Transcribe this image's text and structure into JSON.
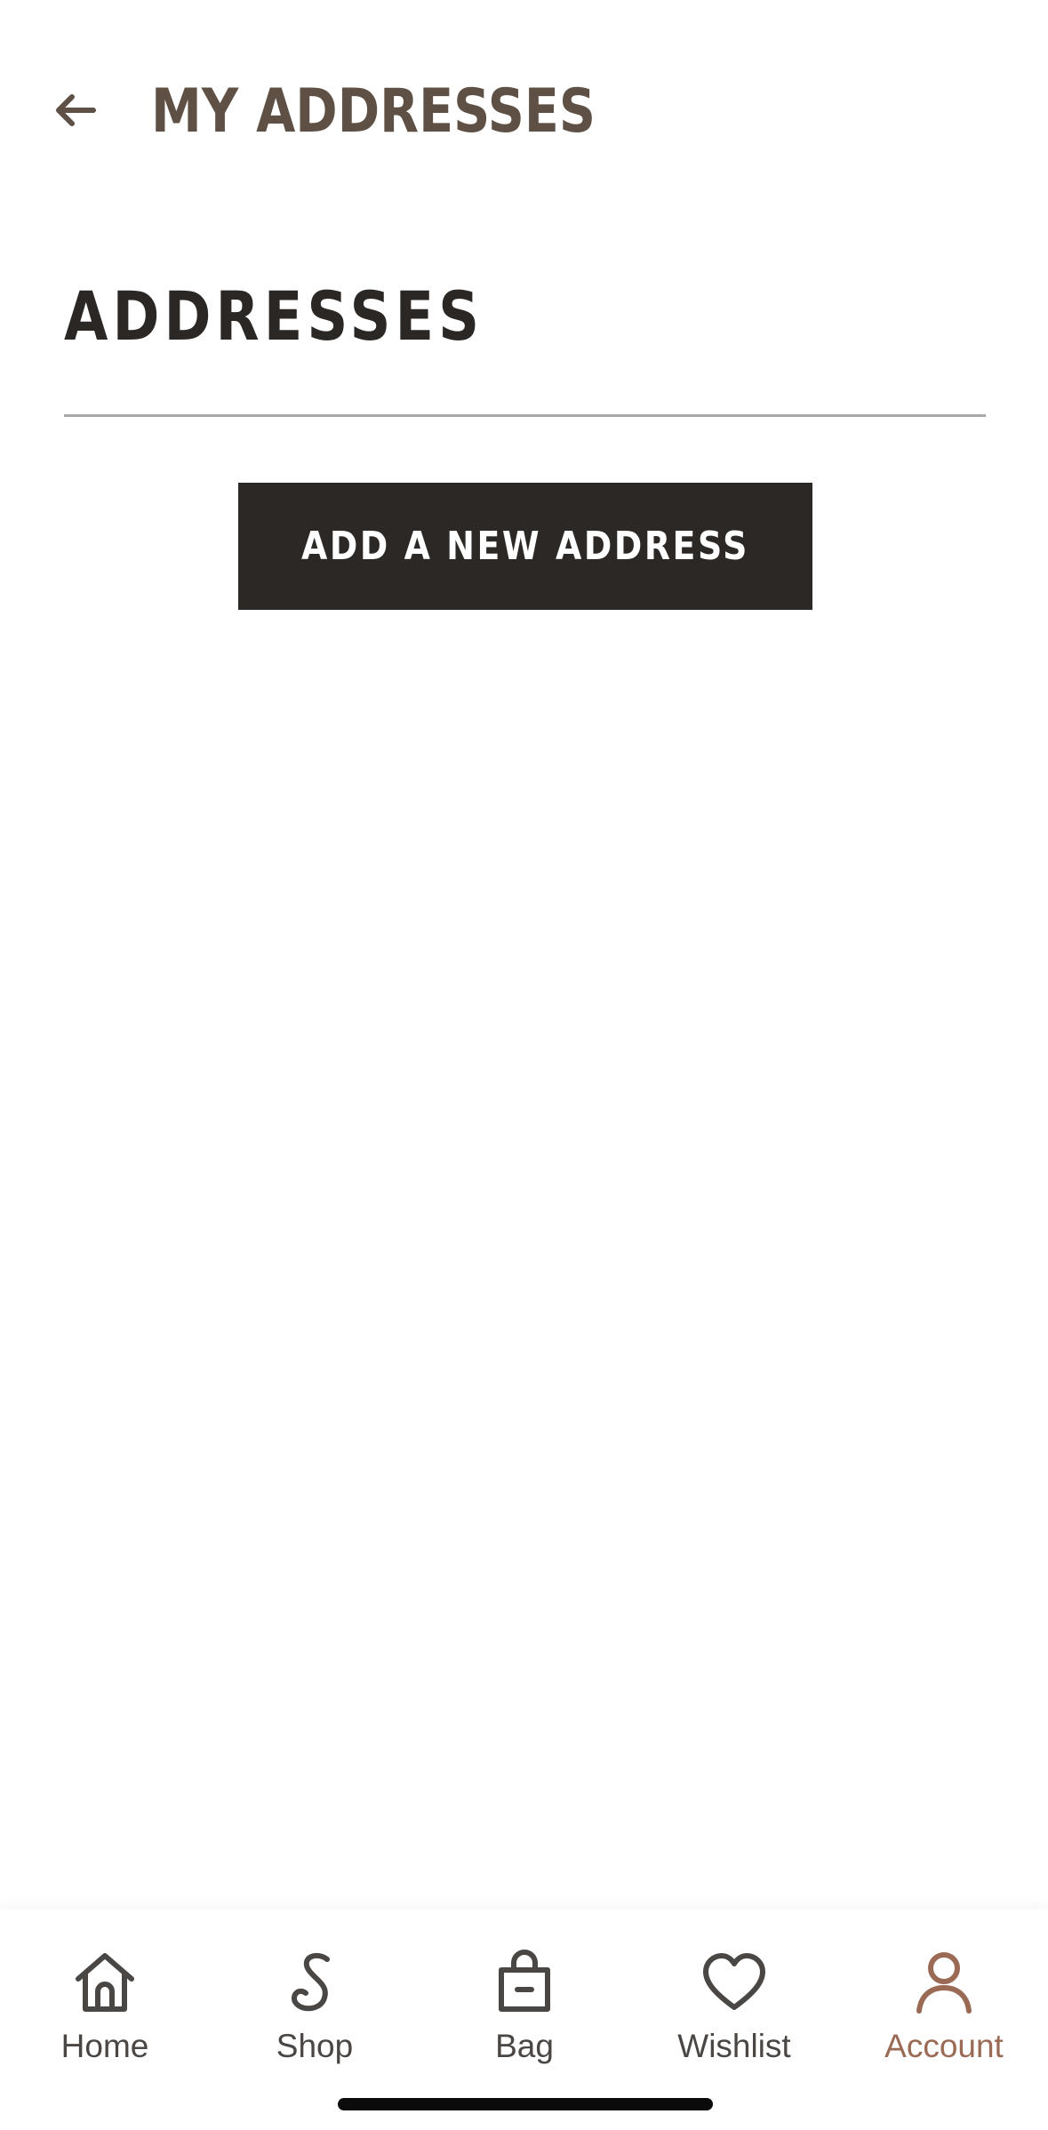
{
  "header": {
    "title": "MY ADDRESSES",
    "back_icon": "arrow-left-icon"
  },
  "section": {
    "title": "ADDRESSES"
  },
  "actions": {
    "add_address_label": "ADD A NEW ADDRESS"
  },
  "tabbar": {
    "active": "Account",
    "active_color": "#9a6a55",
    "tabs": [
      {
        "label": "Home",
        "icon": "home-icon"
      },
      {
        "label": "Shop",
        "icon": "shop-icon"
      },
      {
        "label": "Bag",
        "icon": "bag-icon"
      },
      {
        "label": "Wishlist",
        "icon": "heart-icon"
      },
      {
        "label": "Account",
        "icon": "account-icon"
      }
    ]
  },
  "colors": {
    "header_title": "#5e5045",
    "section_title": "#2a2725",
    "button_bg": "#2c2826",
    "divider": "#a8a8a8"
  }
}
